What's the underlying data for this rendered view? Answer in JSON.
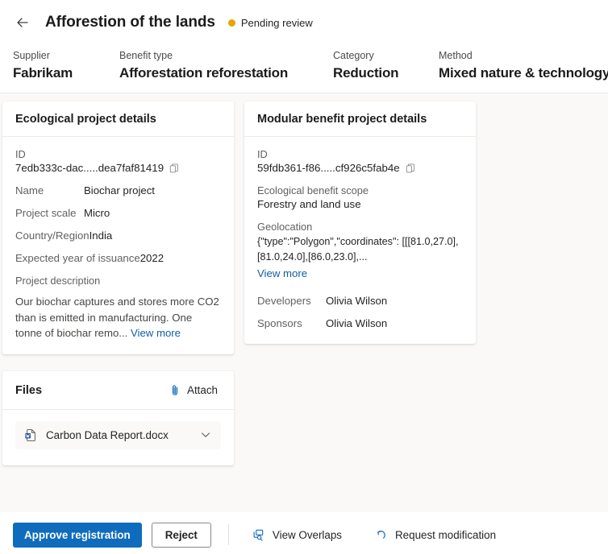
{
  "header": {
    "back_icon": "arrow-left-icon",
    "title": "Afforestion of the lands",
    "status_label": "Pending review",
    "status_color": "#eaa300"
  },
  "meta": [
    {
      "label": "Supplier",
      "value": "Fabrikam"
    },
    {
      "label": "Benefit type",
      "value": "Afforestation reforestation"
    },
    {
      "label": "Category",
      "value": "Reduction"
    },
    {
      "label": "Method",
      "value": "Mixed nature & technology"
    }
  ],
  "ecological_card": {
    "title": "Ecological project details",
    "id_label": "ID",
    "id_value": "7edb333c-dac.....dea7faf81419",
    "copy_icon": "copy-icon",
    "name_label": "Name",
    "name_value": "Biochar project",
    "scale_label": "Project scale",
    "scale_value": "Micro",
    "country_label": "Country/Region",
    "country_value": "India",
    "issuance_label": "Expected year of issuance",
    "issuance_value": "2022",
    "description_label": "Project description",
    "description_text": "Our biochar captures and stores more CO2 than is emitted in manufacturing. One tonne of biochar remo...",
    "view_more_label": "View more"
  },
  "modular_card": {
    "title": "Modular benefit project details",
    "id_label": "ID",
    "id_value": "59fdb361-f86.....cf926c5fab4e",
    "copy_icon": "copy-icon",
    "scope_label": "Ecological benefit scope",
    "scope_value": "Forestry and land use",
    "geolocation_label": "Geolocation",
    "geolocation_value": "{\"type\":\"Polygon\",\"coordinates\": [[[81.0,27.0],[81.0,24.0],[86.0,23.0],...",
    "view_more_label": "View more",
    "developers_label": "Developers",
    "developers_value": "Olivia Wilson",
    "sponsors_label": "Sponsors",
    "sponsors_value": "Olivia Wilson"
  },
  "files_card": {
    "title": "Files",
    "attach_label": "Attach",
    "attach_icon": "paperclip-icon",
    "file_icon": "word-document-icon",
    "file_name": "Carbon Data Report.docx",
    "chevron_icon": "chevron-down-icon"
  },
  "actions": {
    "approve_label": "Approve registration",
    "reject_label": "Reject",
    "view_overlaps_label": "View Overlaps",
    "view_overlaps_icon": "copy-search-icon",
    "request_modification_label": "Request modification",
    "request_modification_icon": "undo-arrow-icon"
  },
  "colors": {
    "primary_blue": "#0f6cbd",
    "link_blue": "#115ea3",
    "status_amber": "#eaa300",
    "page_bg": "#faf9f8"
  }
}
